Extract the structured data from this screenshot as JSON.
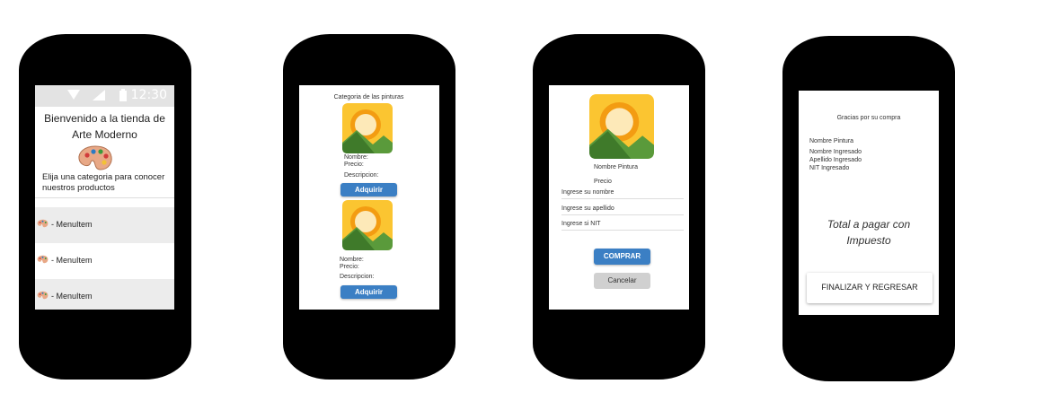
{
  "phone1": {
    "status_time": "12:30",
    "welcome_line1": "Bienvenido a la tienda de",
    "welcome_line2": "Arte Moderno",
    "choose_text": "Elija una categoria para conocer nuestros productos",
    "menu_items": [
      {
        "label": "- MenuItem"
      },
      {
        "label": "- MenuItem"
      },
      {
        "label": "- MenuItem"
      }
    ]
  },
  "phone2": {
    "title": "Categoria de las pinturas",
    "items": [
      {
        "nombre": "Nombre:",
        "precio": "Precio:",
        "descripcion": "Descripcion:",
        "button": "Adquirir"
      },
      {
        "nombre": "Nombre:",
        "precio": "Precio:",
        "descripcion": "Descripcion:",
        "button": "Adquirir"
      }
    ]
  },
  "phone3": {
    "nombre_pintura": "Nombre Pintura",
    "precio": "Precio",
    "input_nombre_placeholder": "Ingrese su nombre",
    "input_apellido_placeholder": "Ingrese su apellido",
    "input_nit_placeholder": "Ingrese si NIT",
    "comprar_button": "COMPRAR",
    "cancelar_button": "Cancelar"
  },
  "phone4": {
    "gracias": "Gracias por su compra",
    "nombre_pintura": "Nombre Pintura",
    "nombre_ingresado": "Nombre Ingresado",
    "apellido_ingresado": "Apellido Ingresado",
    "nit_ingresado": "NIT Ingresado",
    "total_line1": "Total a pagar con",
    "total_line2": "Impuesto",
    "finalizar_button": "FINALIZAR Y REGRESAR"
  },
  "colors": {
    "button_blue": "#3b7fc4",
    "button_gray": "#d0d0d0",
    "statusbar": "#e3e3e3",
    "image_bg": "#fbc531"
  }
}
